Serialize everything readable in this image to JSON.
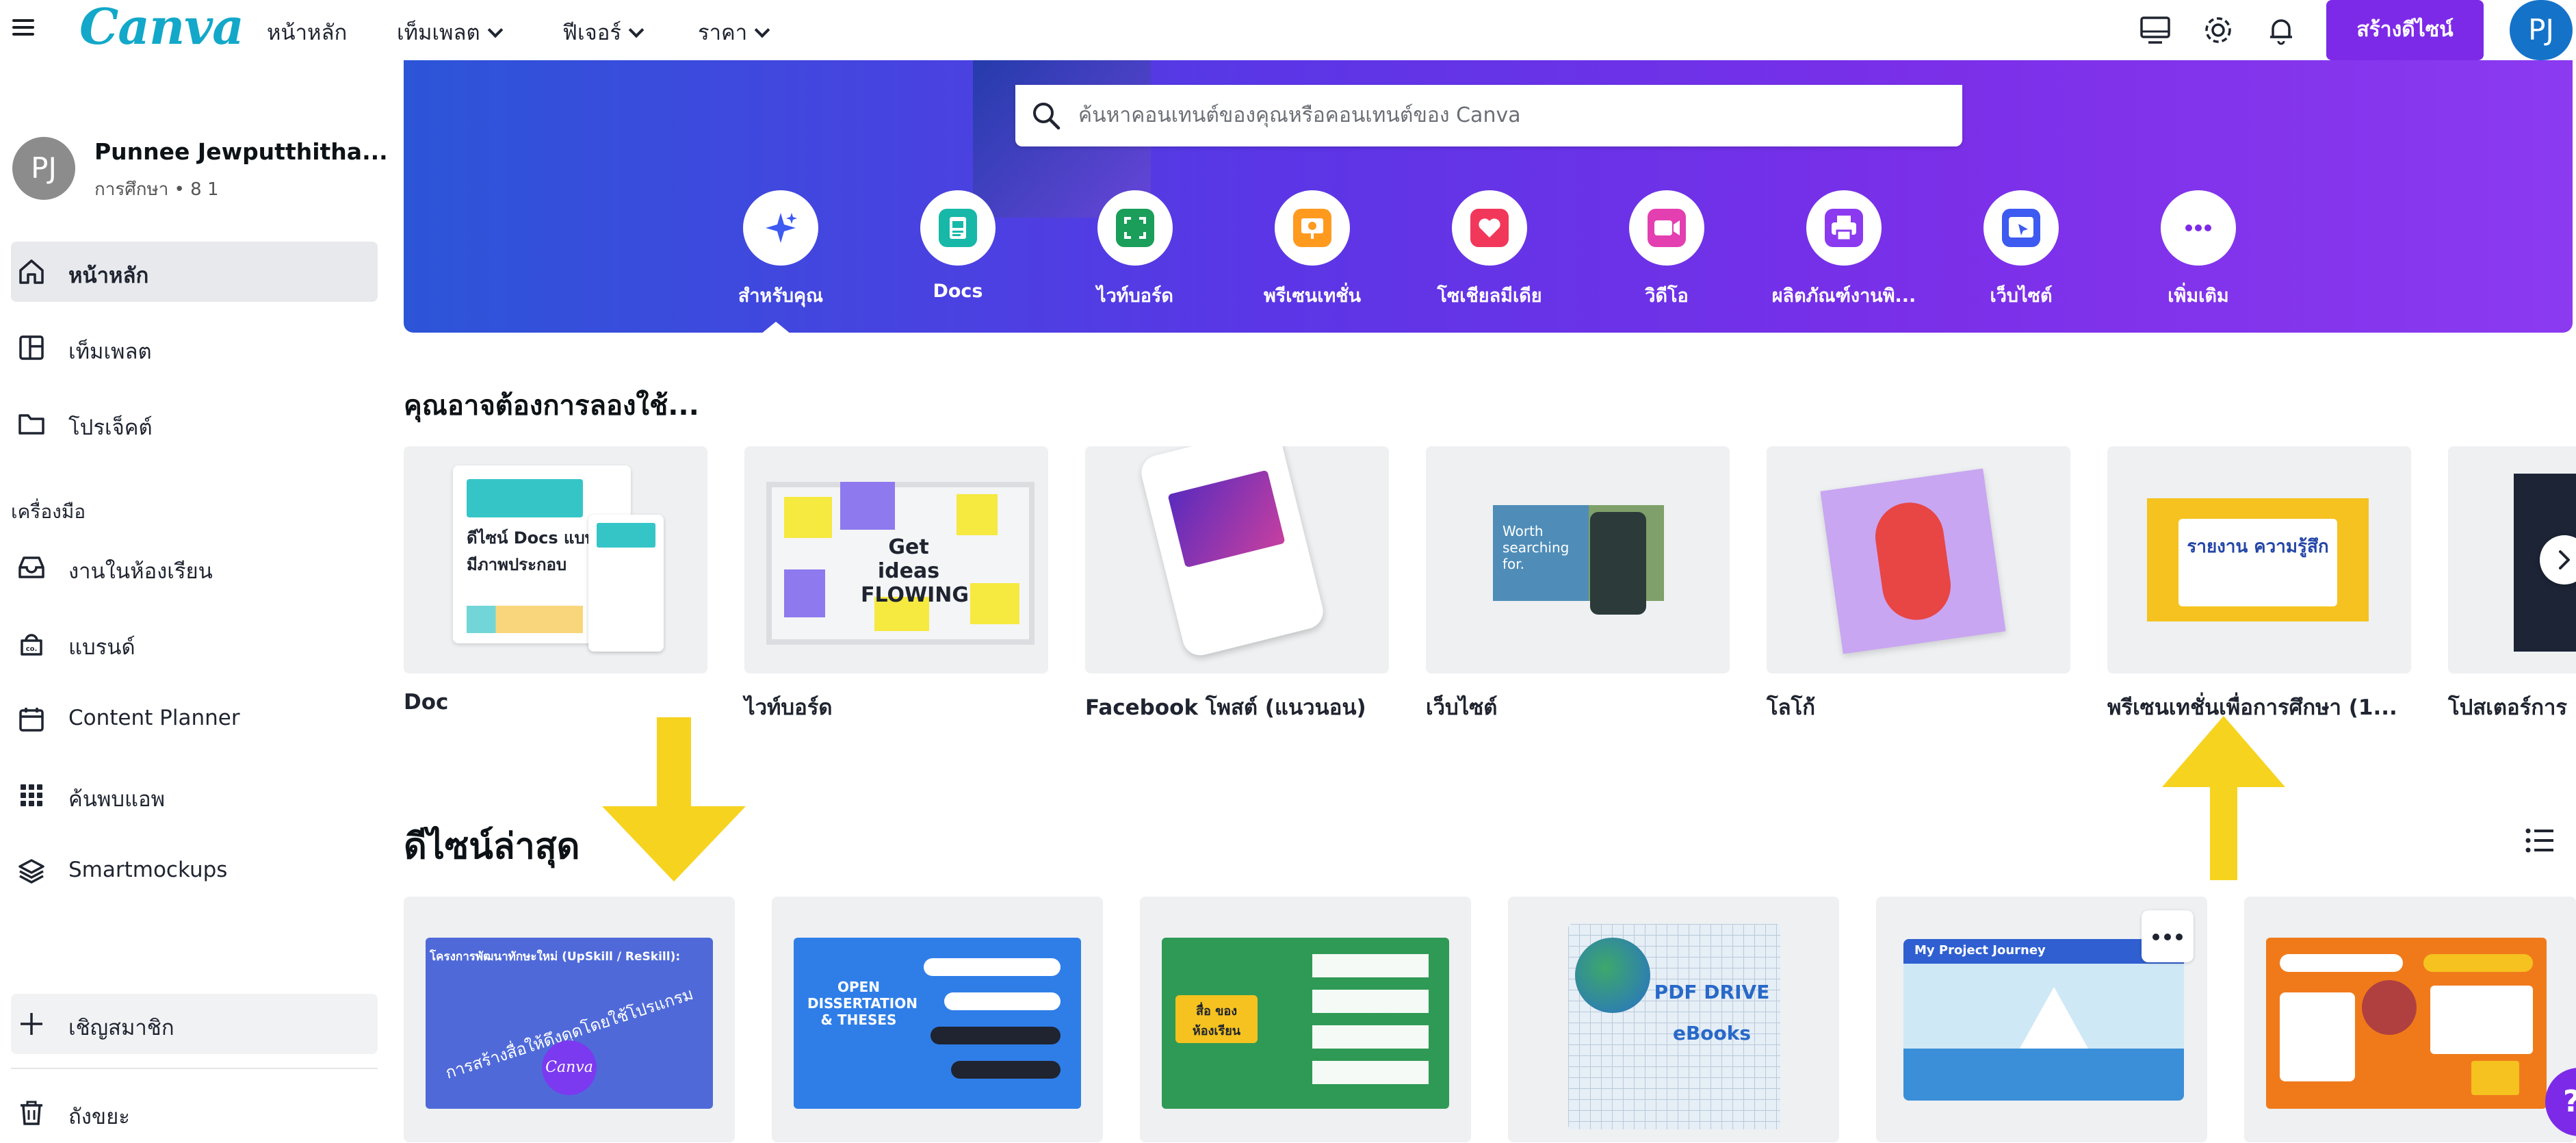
{
  "app": {
    "logo_text": "Canva"
  },
  "topbar": {
    "nav": [
      {
        "label": "หน้าหลัก",
        "has_dropdown": false
      },
      {
        "label": "เท็มเพลต",
        "has_dropdown": true
      },
      {
        "label": "ฟีเจอร์",
        "has_dropdown": true
      },
      {
        "label": "ราคา",
        "has_dropdown": true
      }
    ],
    "create_button": "สร้างดีไซน์",
    "avatar_initials": "PJ",
    "icons": [
      "monitor-icon",
      "gear-icon",
      "bell-icon"
    ]
  },
  "sidebar": {
    "account": {
      "initials": "PJ",
      "name": "Punnee Jewputthitha...",
      "subtitle": "การศึกษา • 8 1"
    },
    "items": [
      {
        "label": "หน้าหลัก",
        "icon": "home-icon",
        "active": true
      },
      {
        "label": "เท็มเพลต",
        "icon": "template-icon",
        "active": false
      },
      {
        "label": "โปรเจ็คต์",
        "icon": "folder-icon",
        "active": false
      }
    ],
    "tools_heading": "เครื่องมือ",
    "tools": [
      {
        "label": "งานในห้องเรียน",
        "icon": "inbox-icon"
      },
      {
        "label": "แบรนด์",
        "icon": "brand-icon"
      },
      {
        "label": "Content Planner",
        "icon": "calendar-icon"
      },
      {
        "label": "ค้นพบแอพ",
        "icon": "apps-grid-icon"
      },
      {
        "label": "Smartmockups",
        "icon": "layers-icon"
      }
    ],
    "invite": "เชิญสมาชิก",
    "trash": "ถังขยะ"
  },
  "hero": {
    "search_placeholder": "ค้นหาคอนเทนต์ของคุณหรือคอนเทนต์ของ Canva",
    "categories": [
      {
        "label": "สำหรับคุณ",
        "icon": "sparkle-icon",
        "color": "#3d5af1"
      },
      {
        "label": "Docs",
        "icon": "doc-icon",
        "color": "#17b8a8"
      },
      {
        "label": "ไวท์บอร์ด",
        "icon": "whiteboard-icon",
        "color": "#1a9e5a"
      },
      {
        "label": "พรีเซนเทชั่น",
        "icon": "presentation-icon",
        "color": "#ff9a1f"
      },
      {
        "label": "โซเชียลมีเดีย",
        "icon": "heart-icon",
        "color": "#f2385a"
      },
      {
        "label": "วิดีโอ",
        "icon": "video-icon",
        "color": "#e33fb0"
      },
      {
        "label": "ผลิตภัณฑ์งานพิ...",
        "icon": "print-icon",
        "color": "#8b3af0"
      },
      {
        "label": "เว็บไซต์",
        "icon": "website-icon",
        "color": "#3d5af1"
      },
      {
        "label": "เพิ่มเติม",
        "icon": "more-icon",
        "color": "#7d2ae8"
      }
    ]
  },
  "suggestions": {
    "title": "คุณอาจต้องการลองใช้...",
    "cards": [
      {
        "label": "Doc",
        "thumb_text": "ดีไซน์ Docs แบบมีภาพประกอบ"
      },
      {
        "label": "ไวท์บอร์ด",
        "thumb_text": "Get ideas FLOWING"
      },
      {
        "label": "Facebook โพสต์ (แนวนอน)",
        "thumb_text": ""
      },
      {
        "label": "เว็บไซต์",
        "thumb_text": "Worth searching for."
      },
      {
        "label": "โลโก้",
        "thumb_text": ""
      },
      {
        "label": "พรีเซนเทชั่นเพื่อการศึกษา (1...",
        "thumb_text": "รายงาน ความรู้สึก"
      },
      {
        "label": "โปสเตอร์การ",
        "thumb_text": ""
      }
    ]
  },
  "recent": {
    "title": "ดีไซน์ล่าสุด",
    "cards": [
      {
        "thumb_text": "การสร้างสื่อให้ดึงดูดโดยใช้โปรแกรม",
        "thumb_title": "โครงการพัฒนาทักษะใหม่ (UpSkill / ReSkill):",
        "thumb_logo": "Canva",
        "bg": "#4f6ad8"
      },
      {
        "thumb_text": "OPEN DISSERTATION & THESES",
        "bg": "#2f7ee8"
      },
      {
        "thumb_text": "สื่อ ของห้องเรียน",
        "bg": "#2f9a55"
      },
      {
        "thumb_text": "PDF DRIVE eBooks",
        "bg": "#d9e6f2"
      },
      {
        "thumb_text": "My Project Journey",
        "bg": "#cfe8f6"
      },
      {
        "thumb_text": "",
        "bg": "#f07a1a"
      }
    ]
  },
  "help_label": "?"
}
